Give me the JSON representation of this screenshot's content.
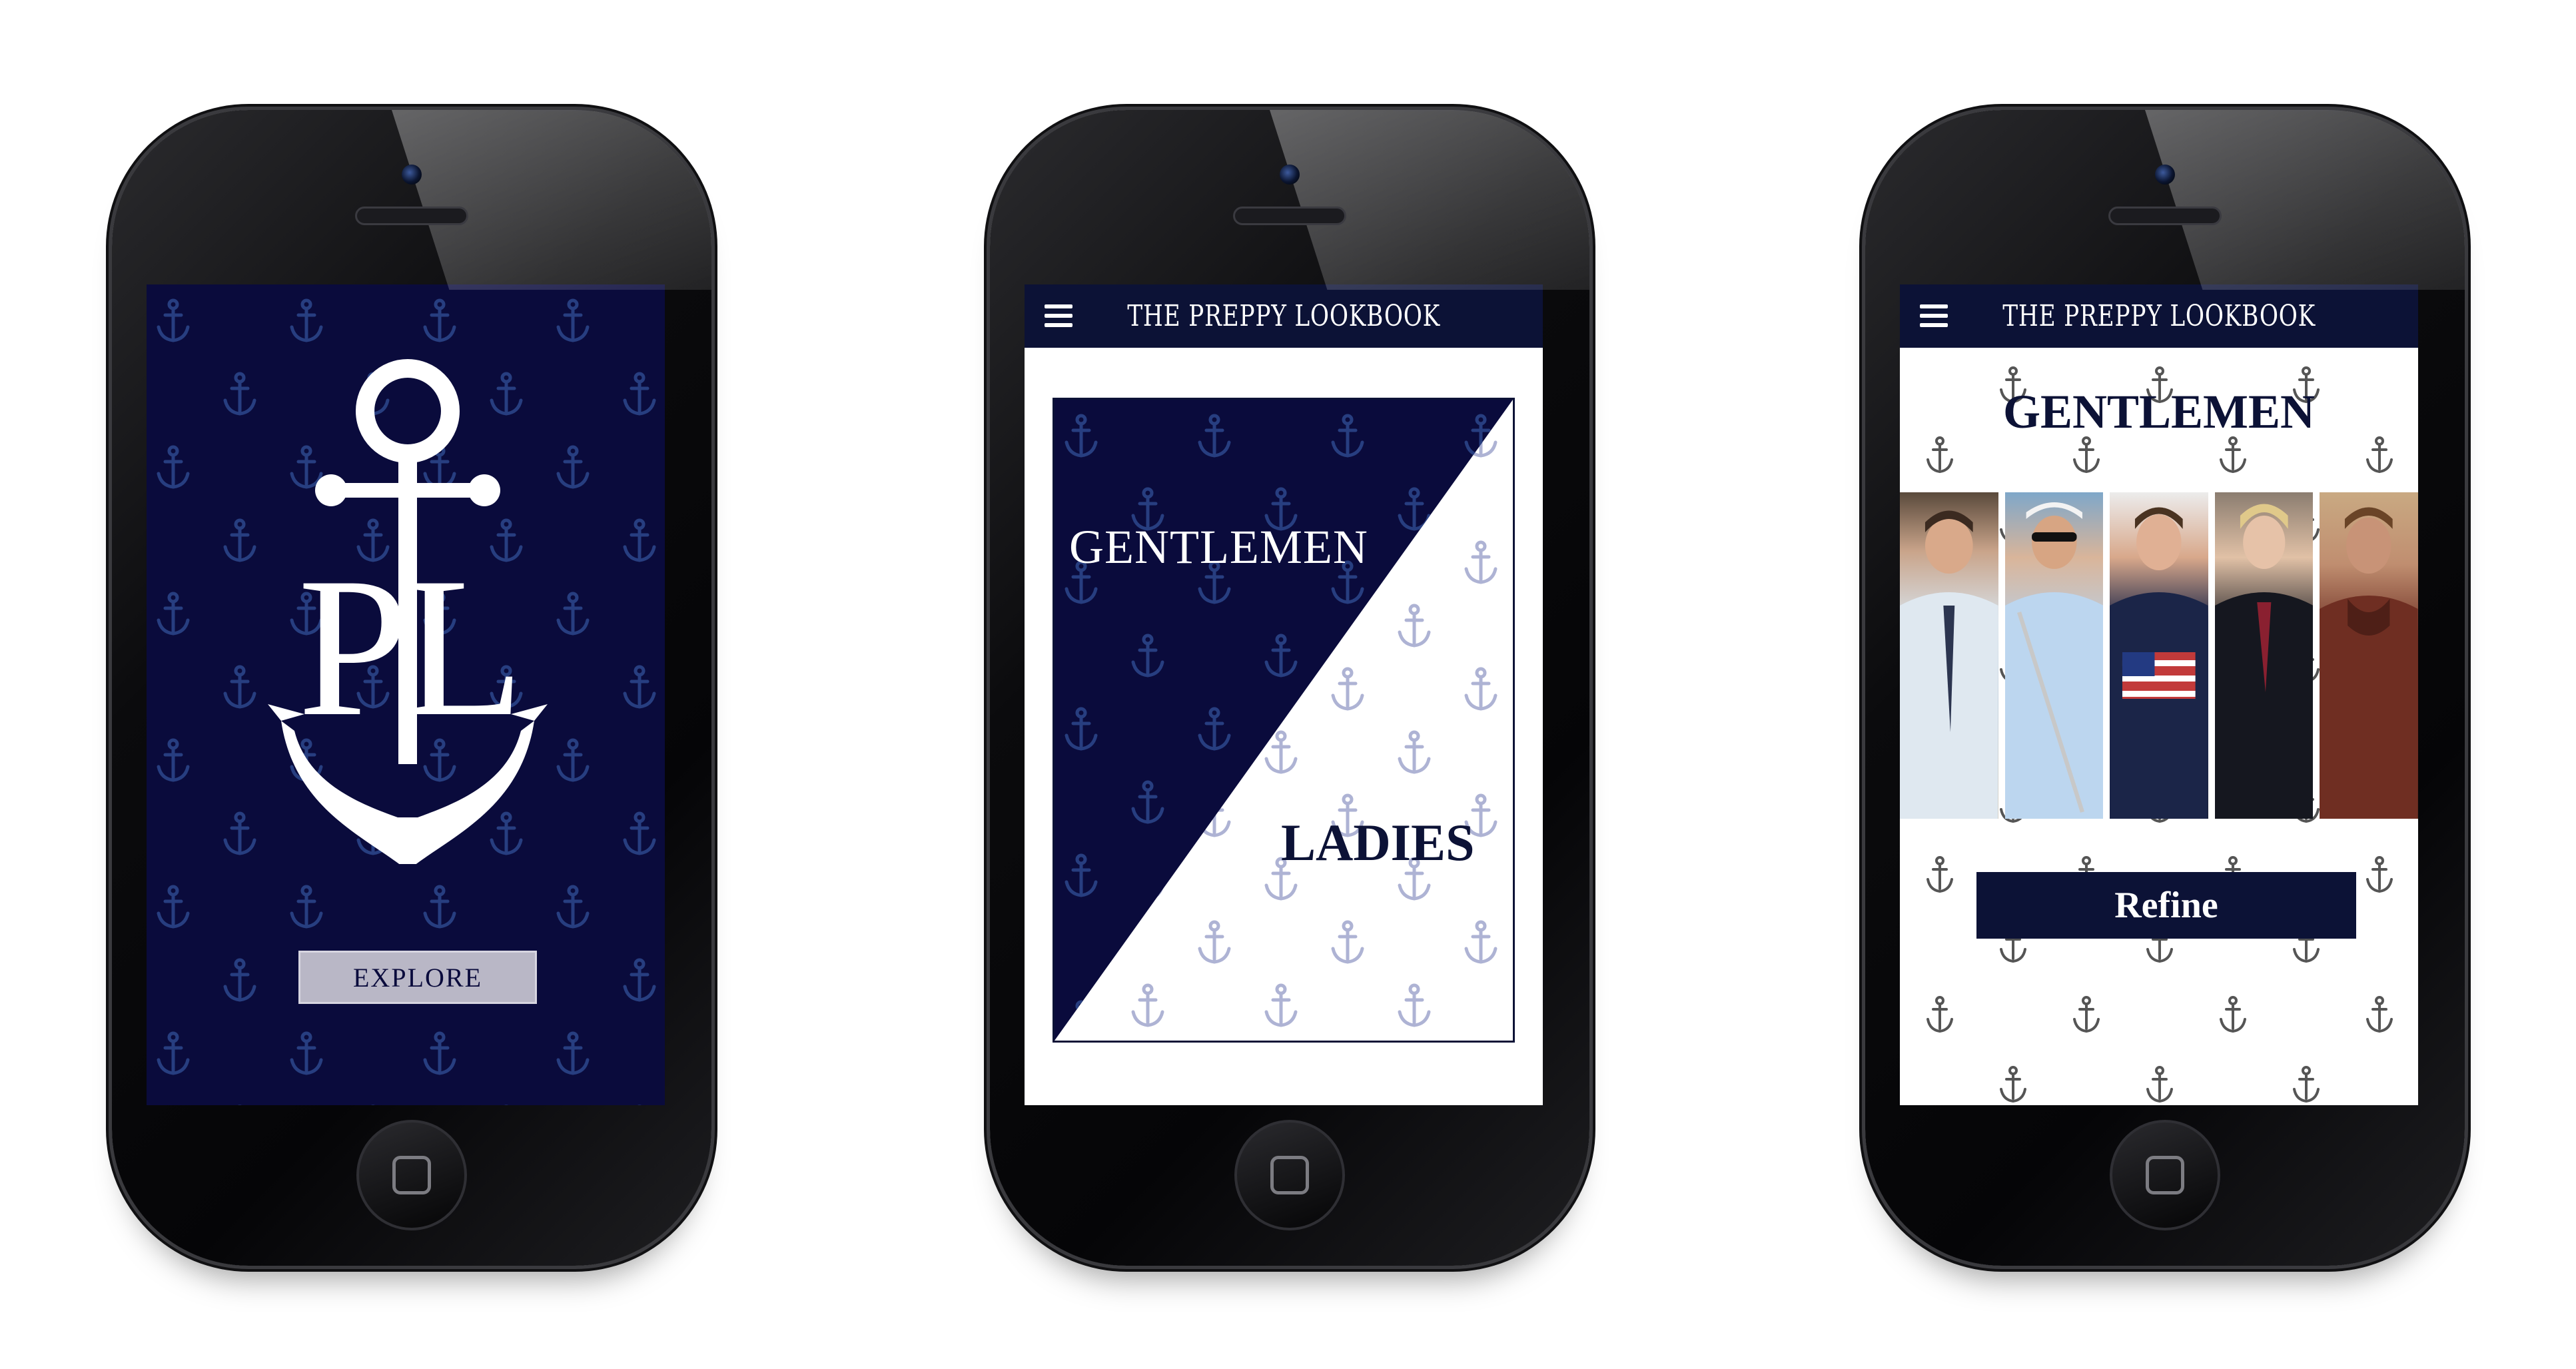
{
  "colors": {
    "navy": "#0a0b3c",
    "header_navy": "#0c1236",
    "explore_button": "#b9b7c6",
    "white": "#ffffff"
  },
  "screen_splash": {
    "logo_monogram": "PL",
    "logo_icon": "anchor-icon",
    "explore_label": "EXPLORE"
  },
  "screen_category": {
    "header_title": "THE PREPPY LOOKBOOK",
    "menu_icon": "hamburger-menu-icon",
    "gentlemen_label": "GENTLEMEN",
    "ladies_label": "LADIES"
  },
  "screen_gentlemen": {
    "header_title": "THE PREPPY LOOKBOOK",
    "menu_icon": "hamburger-menu-icon",
    "section_title": "GENTLEMEN",
    "refine_label": "Refine"
  }
}
